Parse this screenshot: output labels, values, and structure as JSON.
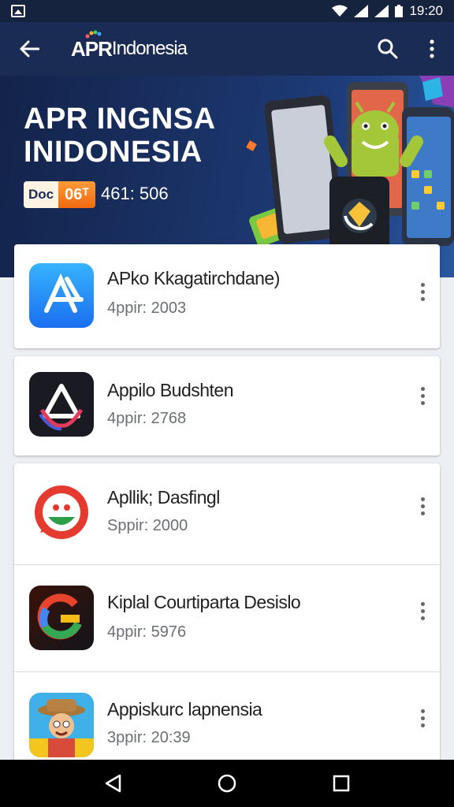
{
  "status_bar": {
    "time": "19:20"
  },
  "app_bar": {
    "brand_mark": "APR",
    "brand_name": "Indonesia",
    "icons": [
      "back-arrow-icon",
      "search-icon",
      "more-vert-icon"
    ]
  },
  "banner": {
    "title_line1": "APR INGNSA",
    "title_line2": "INIDONESIA",
    "badge_left": "Doc",
    "badge_right": "06ᵀ",
    "code": "461: 506"
  },
  "apps": [
    {
      "name": "APko Kkagatirchdane)",
      "meta": "4ppir: 2003",
      "icon": "app-store-a-icon"
    },
    {
      "name": "Appilo Budshten",
      "meta": "4ppir: 2768",
      "icon": "triangle-logo-icon"
    },
    {
      "name": "Apllik; Dasfingl",
      "meta": "Sppir: 2000",
      "icon": "chat-face-icon"
    },
    {
      "name": "Kiplal Courtiparta Desislo",
      "meta": "4ppir: 5976",
      "icon": "google-g-icon"
    },
    {
      "name": "Appiskurc lapnensia",
      "meta": "3ppir: 20:39",
      "icon": "character-icon"
    }
  ],
  "colors": {
    "app_bar": "#1b2c54",
    "status_bar": "#16233f",
    "badge_orange": "#f06a10",
    "background": "#eceff3"
  },
  "nav_bar": {
    "icons": [
      "back-triangle-icon",
      "home-circle-icon",
      "recents-square-icon"
    ]
  }
}
